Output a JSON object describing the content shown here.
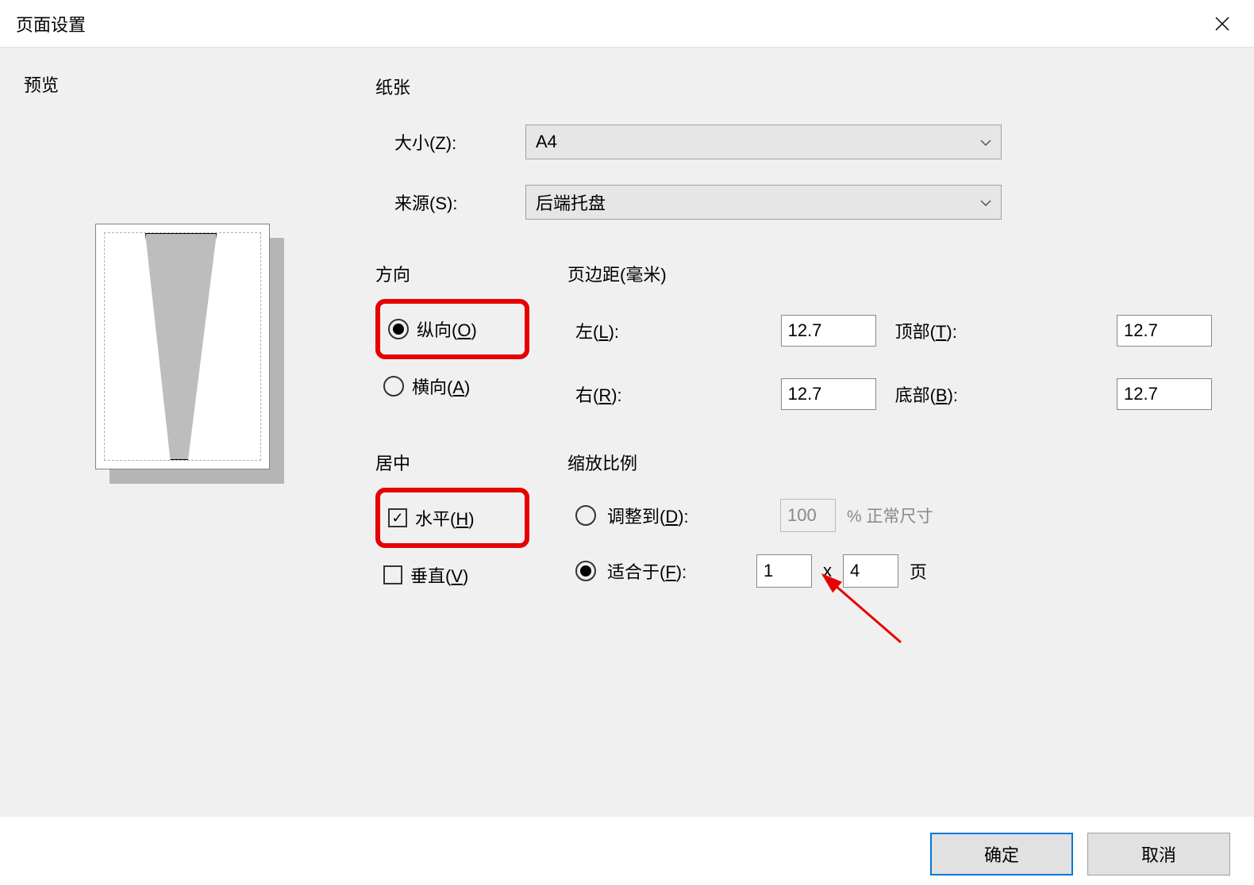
{
  "title": "页面设置",
  "preview": {
    "label": "预览"
  },
  "paper": {
    "title": "纸张",
    "size_label": "大小(Z):",
    "size_value": "A4",
    "source_label": "来源(S):",
    "source_value": "后端托盘"
  },
  "orientation": {
    "title": "方向",
    "portrait": "纵向(O)",
    "landscape": "横向(A)"
  },
  "margins": {
    "title": "页边距(毫米)",
    "left_label": "左(L):",
    "left_value": "12.7",
    "top_label": "顶部(T):",
    "top_value": "12.7",
    "right_label": "右(R):",
    "right_value": "12.7",
    "bottom_label": "底部(B):",
    "bottom_value": "12.7"
  },
  "centering": {
    "title": "居中",
    "horizontal": "水平(H)",
    "vertical": "垂直(V)"
  },
  "scaling": {
    "title": "缩放比例",
    "adjust_label": "调整到(D):",
    "adjust_value": "100",
    "adjust_suffix": "% 正常尺寸",
    "fit_label": "适合于(F):",
    "fit_wide": "1",
    "fit_sep": "x",
    "fit_tall": "4",
    "fit_suffix": "页"
  },
  "buttons": {
    "ok": "确定",
    "cancel": "取消"
  }
}
